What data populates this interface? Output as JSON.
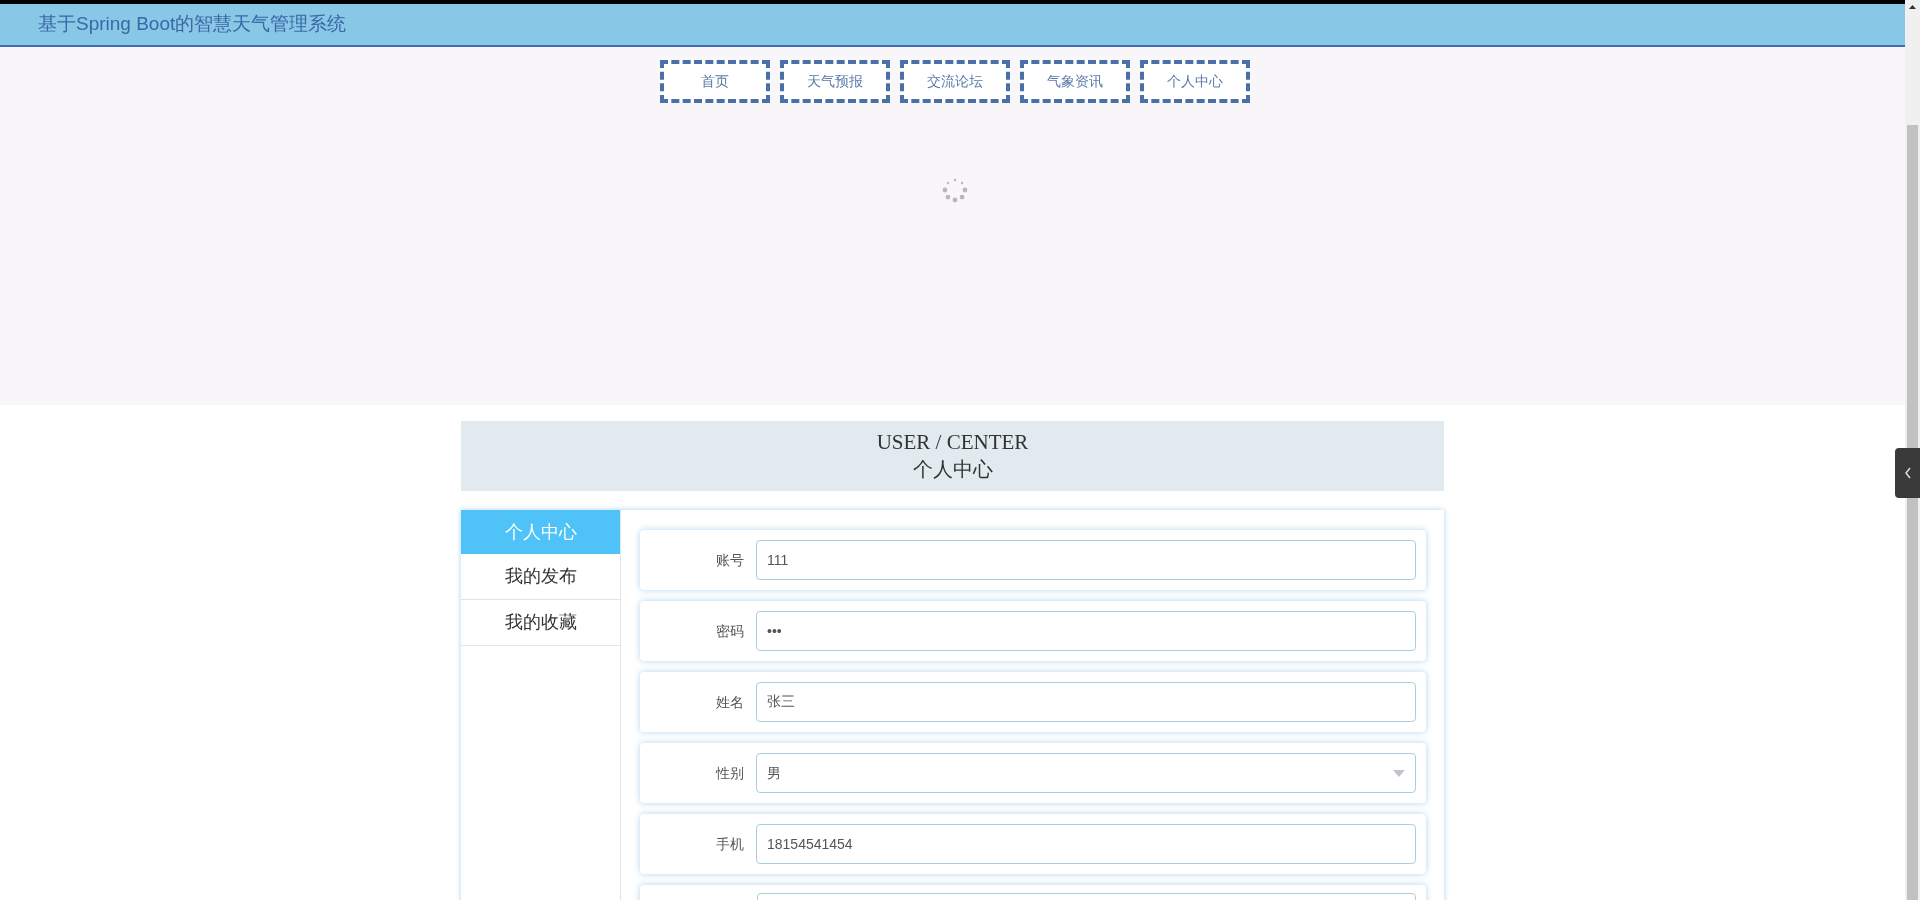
{
  "header": {
    "title": "基于Spring Boot的智慧天气管理系统"
  },
  "nav": [
    {
      "label": "首页"
    },
    {
      "label": "天气预报"
    },
    {
      "label": "交流论坛"
    },
    {
      "label": "气象资讯"
    },
    {
      "label": "个人中心"
    }
  ],
  "section_title": {
    "english": "USER / CENTER",
    "chinese": "个人中心"
  },
  "sidebar": {
    "items": [
      {
        "label": "个人中心",
        "selected": true
      },
      {
        "label": "我的发布",
        "selected": false
      },
      {
        "label": "我的收藏",
        "selected": false
      }
    ]
  },
  "form": {
    "fields": [
      {
        "kind": "text",
        "label": "账号",
        "value": "111"
      },
      {
        "kind": "text",
        "label": "密码",
        "value": "•••"
      },
      {
        "kind": "text",
        "label": "姓名",
        "value": "张三"
      },
      {
        "kind": "select",
        "label": "性别",
        "value": "男"
      },
      {
        "kind": "text",
        "label": "手机",
        "value": "18154541454"
      }
    ]
  }
}
